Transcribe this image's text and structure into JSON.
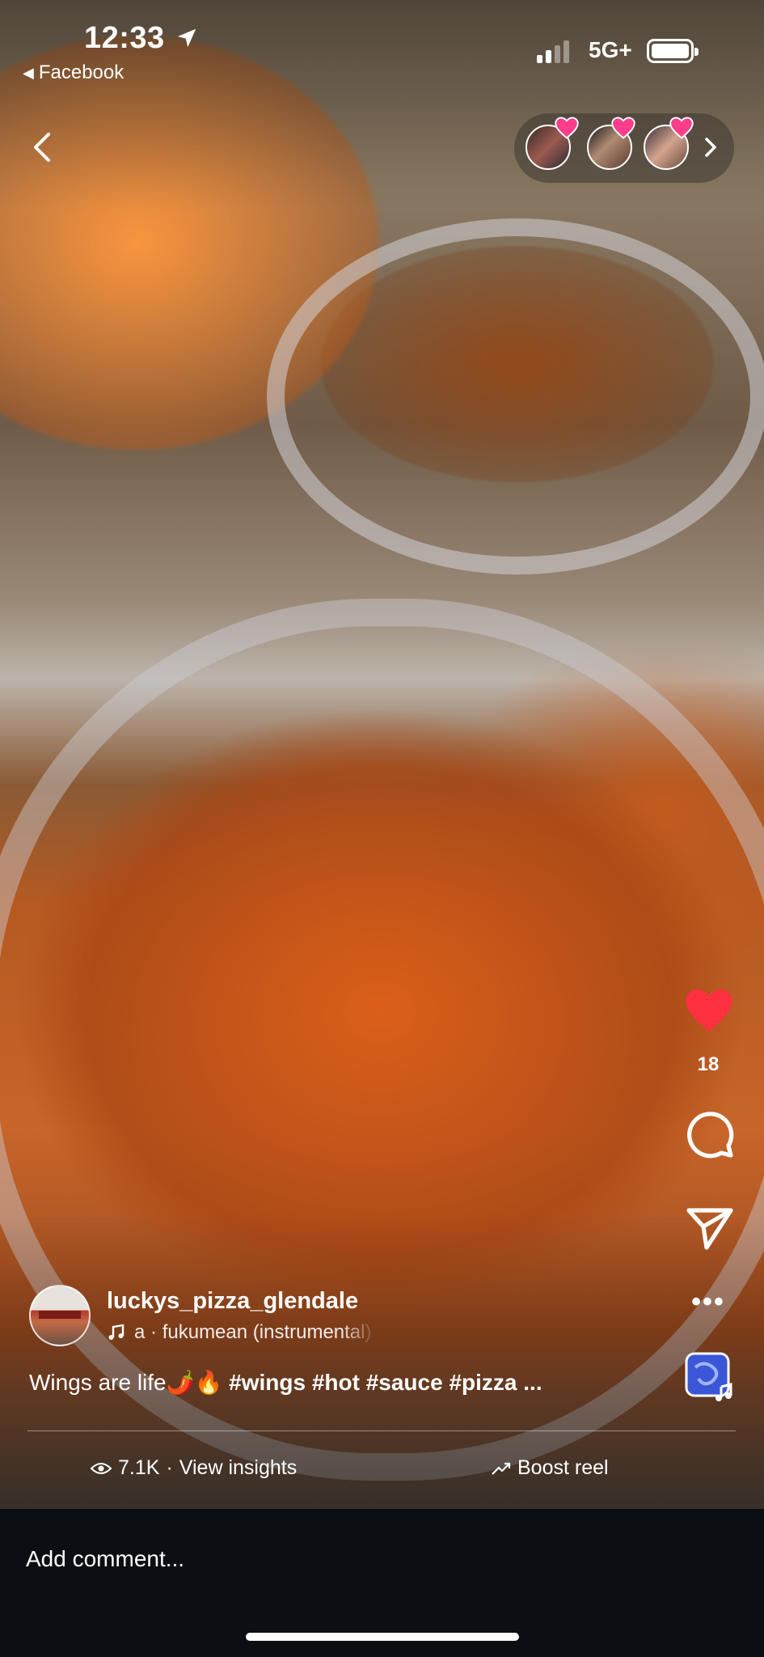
{
  "status_bar": {
    "time": "12:33",
    "back_app_label": "Facebook",
    "network": "5G+",
    "battery_percent": 100
  },
  "viewers": {
    "avatars": [
      "viewer-1",
      "viewer-2",
      "viewer-3"
    ]
  },
  "actions": {
    "like_count": "18",
    "more_label": "•••"
  },
  "post": {
    "username": "luckys_pizza_glendale",
    "audio_prefix": "a",
    "audio_sep": "·",
    "audio_track": "fukumean (instrumental)",
    "caption_text": "Wings are life",
    "caption_emoji": "🌶️🔥",
    "caption_tags": "#wings #hot #sauce #pizza ..."
  },
  "stats": {
    "views": "7.1K",
    "sep": "·",
    "insights_label": "View insights",
    "boost_label": "Boost reel"
  },
  "comment": {
    "placeholder": "Add comment..."
  },
  "colors": {
    "like": "#ff3040",
    "background": "#0b0f14"
  }
}
